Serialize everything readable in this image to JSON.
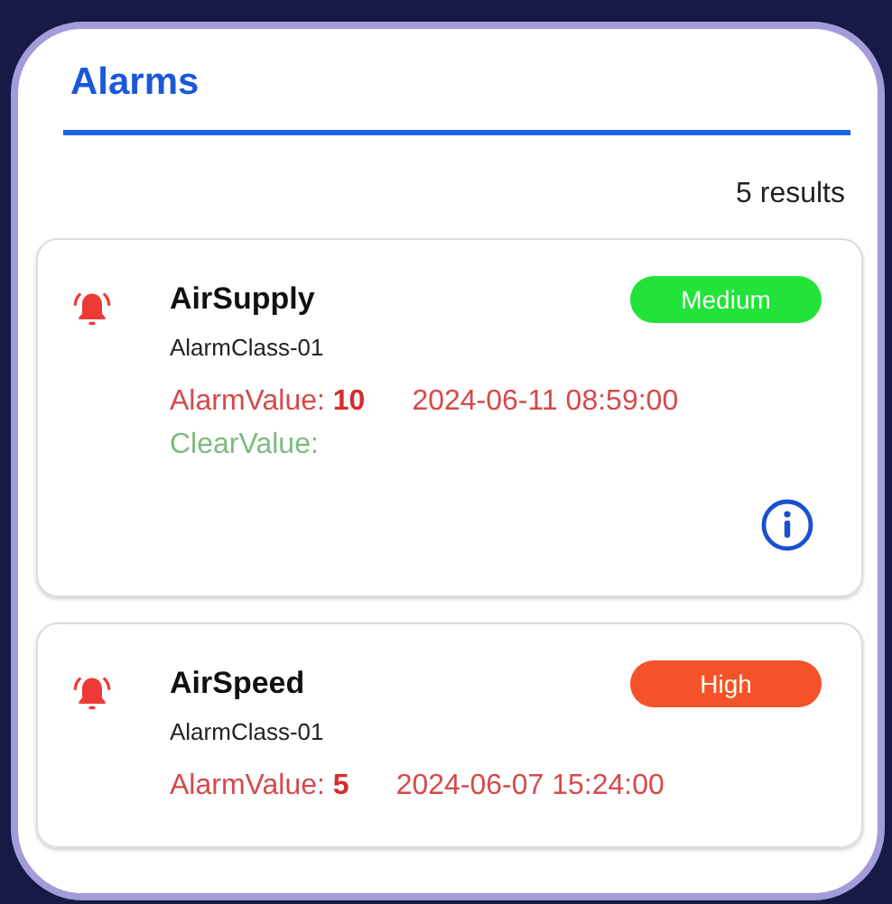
{
  "header": {
    "title": "Alarms"
  },
  "result_count": "5 results",
  "alarms": [
    {
      "name": "AirSupply",
      "class_name": "AlarmClass-01",
      "severity": {
        "label": "Medium",
        "color": "#22e33a"
      },
      "alarm_label": "AlarmValue:",
      "alarm_value": "10",
      "time": "2024-06-11 08:59:00",
      "clear_label": "ClearValue:",
      "show_info": true
    },
    {
      "name": "AirSpeed",
      "class_name": "AlarmClass-01",
      "severity": {
        "label": "High",
        "color": "#f4532a"
      },
      "alarm_label": "AlarmValue:",
      "alarm_value": "5",
      "time": "2024-06-07 15:24:00",
      "show_info": false
    }
  ]
}
